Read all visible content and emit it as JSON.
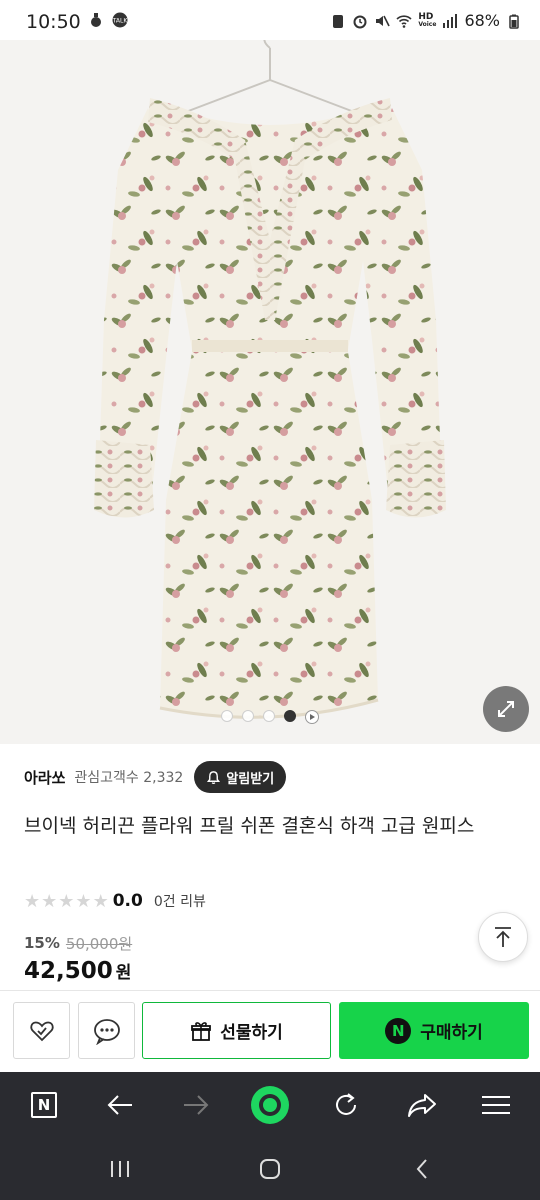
{
  "status_bar": {
    "time": "10:50",
    "battery": "68%",
    "left_icons": [
      "notification-icon",
      "talk-icon"
    ],
    "right_icons": [
      "battery-saver-icon",
      "alarm-icon",
      "mute-icon",
      "wifi-icon",
      "hd-voice-icon",
      "signal-icon",
      "battery-icon"
    ],
    "hd_label": "HD",
    "voice_label": "Voice"
  },
  "gallery": {
    "image_count": 5,
    "active_index": 3
  },
  "seller": {
    "name": "아라쏘",
    "followers": "관심고객수 2,332",
    "alarm_label": "알림받기"
  },
  "product": {
    "title": "브이넥 허리끈 플라워 프릴 쉬폰 결혼식 하객 고급 원피스",
    "rating": "0.0",
    "reviews": "0건 리뷰",
    "discount": "15%",
    "original_price": "50,000원",
    "price": "42,500",
    "currency": "원"
  },
  "actions": {
    "gift_label": "선물하기",
    "buy_label": "구매하기",
    "npay_letter": "N"
  },
  "browser": {
    "n_label": "N"
  },
  "colors": {
    "buy_green": "#17d34a",
    "gift_border": "#0fb83b",
    "nav_bg": "#2a2b30"
  }
}
